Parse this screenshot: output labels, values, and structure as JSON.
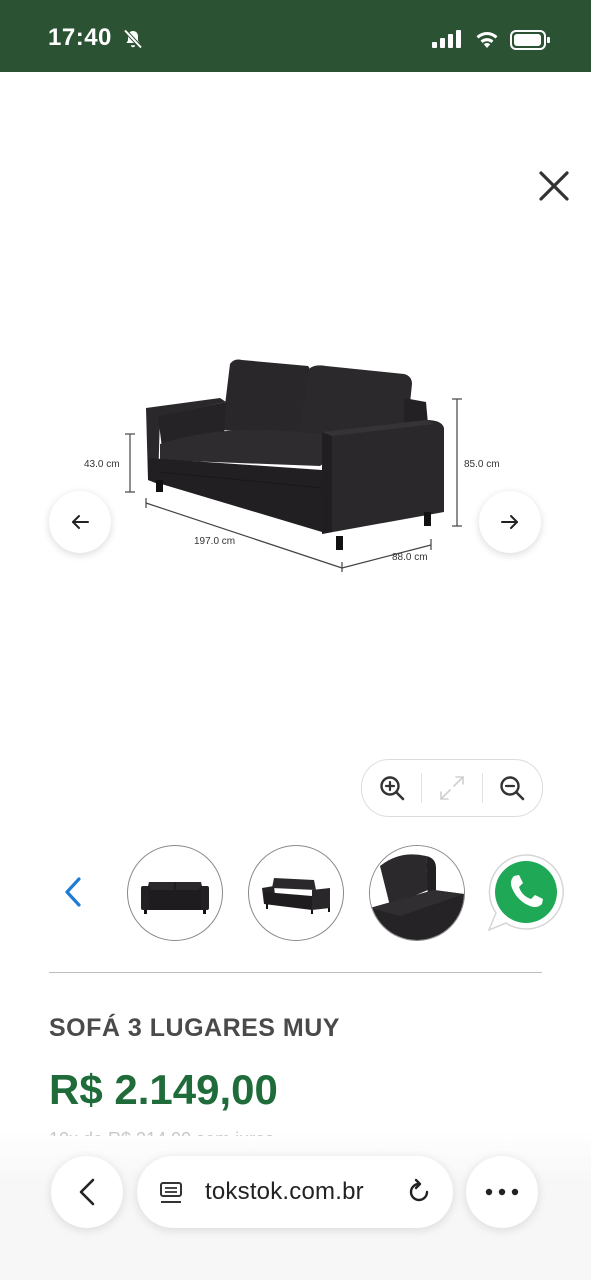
{
  "status_bar": {
    "time": "17:40",
    "background": "#2c5234"
  },
  "icons": {
    "close": "close-icon",
    "prev": "arrow-left-icon",
    "next": "arrow-right-icon",
    "zoom_in": "zoom-in-icon",
    "fullscreen": "expand-icon",
    "zoom_out": "zoom-out-icon",
    "thumb_prev": "chevron-left-icon",
    "whatsapp": "whatsapp-icon",
    "browser_back": "chevron-left-icon",
    "site_info": "page-icon",
    "reload": "reload-icon",
    "more": "more-icon"
  },
  "product_image": {
    "dim_height_seat": "43.0 cm",
    "dim_height_total": "85.0 cm",
    "dim_width": "197.0 cm",
    "dim_depth": "88.0 cm"
  },
  "product": {
    "title": "SOFÁ 3 LUGARES MUY",
    "price": "R$ 2.149,00",
    "installment_partial": "10x de R$ 214,90 sem juros",
    "price_color": "#1f6b3a"
  },
  "browser": {
    "url": "tokstok.com.br"
  }
}
